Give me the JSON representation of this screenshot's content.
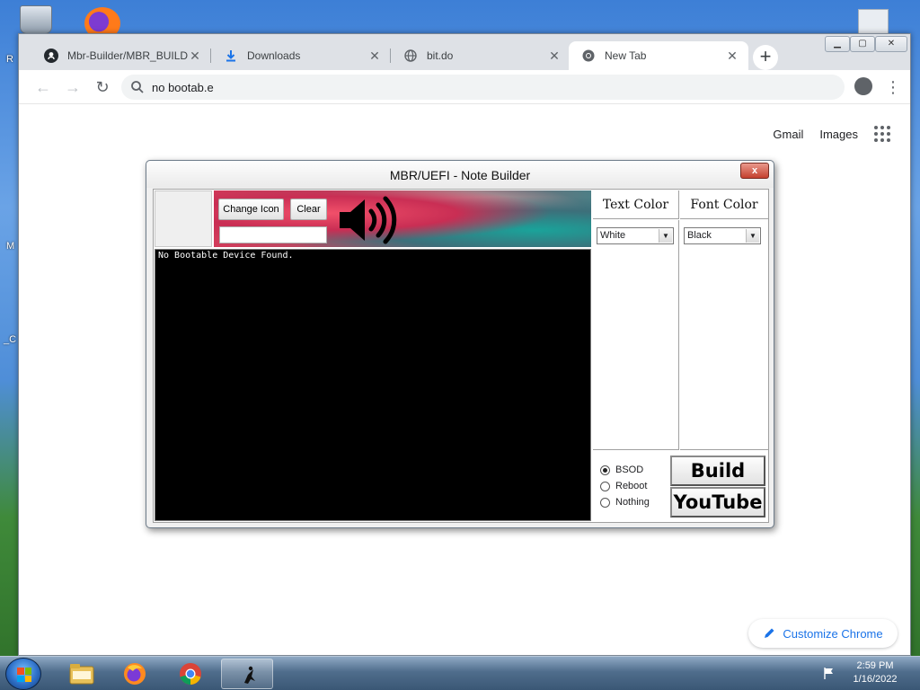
{
  "desktop": {
    "left_letters": [
      "R",
      "M",
      "_C"
    ],
    "right_label": ""
  },
  "browser": {
    "tabs": [
      {
        "title": "Mbr-Builder/MBR_BUILDI",
        "icon": "github-icon"
      },
      {
        "title": "Downloads",
        "icon": "download-icon"
      },
      {
        "title": "bit.do",
        "icon": "globe-icon"
      },
      {
        "title": "New Tab",
        "icon": "chrome-icon",
        "active": true
      }
    ],
    "new_tab_label": "+",
    "address": "no bootab.e",
    "ntp_links": {
      "gmail": "Gmail",
      "images": "Images"
    },
    "customize_label": "Customize Chrome"
  },
  "dialog": {
    "title": "MBR/UEFI - Note Builder",
    "close_label": "x",
    "change_icon_label": "Change Icon",
    "clear_label": "Clear",
    "icon_path_value": "",
    "console_text": "No Bootable Device Found.",
    "text_color_header": "Text Color",
    "font_color_header": "Font Color",
    "text_color_value": "White",
    "font_color_value": "Black",
    "radio_options": [
      {
        "label": "BSOD",
        "checked": true
      },
      {
        "label": "Reboot",
        "checked": false
      },
      {
        "label": "Nothing",
        "checked": false
      }
    ],
    "build_label": "Build",
    "youtube_label": "YouTube"
  },
  "taskbar": {
    "apps": [
      "explorer-icon",
      "firefox-icon",
      "chrome-icon",
      "app-icon"
    ],
    "active_app": "app-icon",
    "time": "2:59 PM",
    "date": "1/16/2022"
  },
  "colors": {
    "chrome_accent": "#1a73e8",
    "console_bg": "#000000",
    "console_fg": "#ffffff"
  }
}
